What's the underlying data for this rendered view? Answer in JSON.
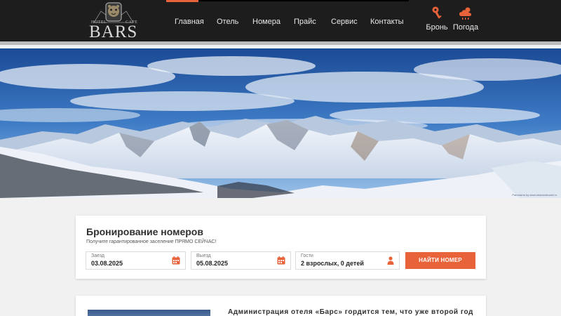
{
  "header": {
    "logo": {
      "word": "BARS",
      "left_word": "HOTEL",
      "right_word": "CAFE"
    },
    "nav": [
      {
        "label": "Главная"
      },
      {
        "label": "Отель"
      },
      {
        "label": "Номера"
      },
      {
        "label": "Прайс"
      },
      {
        "label": "Сервис"
      },
      {
        "label": "Контакты"
      }
    ],
    "actions": {
      "booking_label": "Бронь",
      "weather_label": "Погода"
    },
    "accent_color": "#e8633a",
    "background_color": "#1d1d1d"
  },
  "hero": {
    "image": "panorama of snowy mountain range under blue cloudy sky",
    "credit": "Panorama by www.skisnowboard.ru"
  },
  "booking": {
    "title": "Бронирование номеров",
    "subtitle": "Получите гарантированное заселение ПРЯМО СЕЙЧАС!",
    "checkin": {
      "label": "Заезд",
      "value": "03.08.2025"
    },
    "checkout": {
      "label": "Выезд",
      "value": "05.08.2025"
    },
    "guests": {
      "label": "Гости",
      "value": "2 взрослых, 0 детей"
    },
    "button_label": "НАЙТИ НОМЕР"
  },
  "about": {
    "text": "Администрация отеля «Барс» гордится тем, что уже второй год"
  }
}
